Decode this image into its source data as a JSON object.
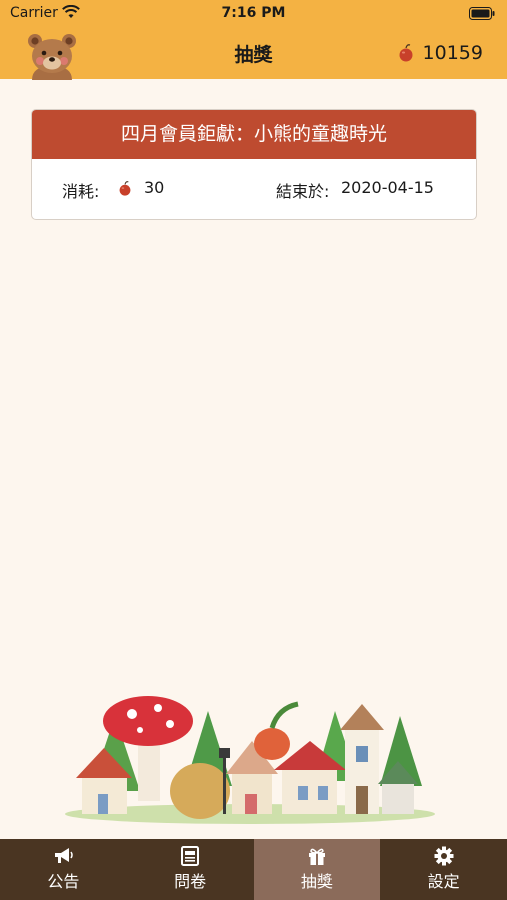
{
  "status_bar": {
    "carrier": "Carrier",
    "time": "7:16 PM"
  },
  "nav": {
    "title": "抽獎",
    "points": "10159",
    "avatar_icon": "bear-icon",
    "points_icon": "apple-icon"
  },
  "event": {
    "title": "四月會員鉅獻：小熊的童趣時光",
    "cost_label": "消耗:",
    "cost_value": "30",
    "end_label": "結束於:",
    "end_date": "2020-04-15"
  },
  "tabs": [
    {
      "label": "公告",
      "icon": "megaphone-icon",
      "active": false
    },
    {
      "label": "問卷",
      "icon": "form-icon",
      "active": false
    },
    {
      "label": "抽獎",
      "icon": "gift-icon",
      "active": true
    },
    {
      "label": "設定",
      "icon": "gear-icon",
      "active": false
    }
  ],
  "colors": {
    "header": "#f4b243",
    "background": "#fdf6ee",
    "card_title": "#be4b30",
    "tab_bar": "#4a3522",
    "tab_active": "#8b6b5a",
    "apple": "#c8402a"
  }
}
